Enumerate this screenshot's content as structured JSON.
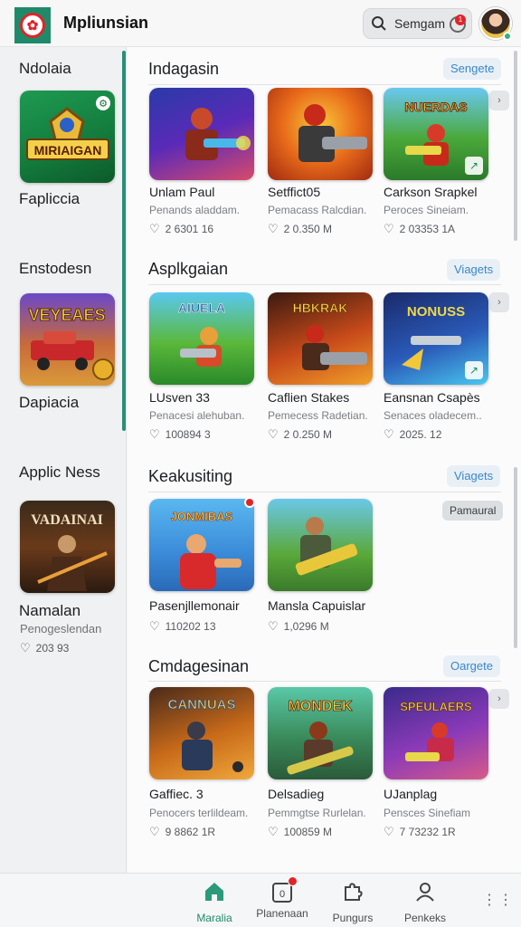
{
  "header": {
    "app_title": "Mpliunsian",
    "search_placeholder": "Semgam",
    "notification_count": "1"
  },
  "sidebar": {
    "groups": [
      {
        "heading": "Ndolaia",
        "card_art": "MIRIAIGAN",
        "label": "Fapliccia"
      },
      {
        "heading": "Enstodesn",
        "card_art": "VEYEAES",
        "label": "Dapiacia"
      },
      {
        "heading": "Applic Ness",
        "card_art": "VADAINAI",
        "label": "Namalan",
        "sub": "Penogeslendan",
        "meta": "203 93"
      }
    ]
  },
  "sections": [
    {
      "title": "Indagasin",
      "action": "Sengete",
      "tiles": [
        {
          "title": "Unlam Paul",
          "sub": "Penands aladdam.",
          "meta": "2 6301 16"
        },
        {
          "title": "Setffict05",
          "sub": "Pemacass Ralcdian.",
          "meta": "2 0.350 M"
        },
        {
          "title": "Carkson Srapkel",
          "sub": "Peroces Sineiam.",
          "meta": "2 03353 1A",
          "art": "NUERDAS"
        }
      ]
    },
    {
      "title": "Asplkgaian",
      "action": "Viagets",
      "tiles": [
        {
          "title": "LUsven 33",
          "sub": "Penacesi alehuban.",
          "meta": "100894 3",
          "art": "AIUELA"
        },
        {
          "title": "Caflien Stakes",
          "sub": "Pemecess Radetian.",
          "meta": "2 0.250 M",
          "art": "HBKRAK"
        },
        {
          "title": "Eansnan Csapès",
          "sub": "Senaces oladecem..",
          "meta": "2025. 12",
          "art": "NONUSS"
        }
      ]
    },
    {
      "title": "Keakusiting",
      "action": "Viagets",
      "side_button": "Pamaural",
      "tiles": [
        {
          "title": "Pasenjllemonair",
          "sub": "",
          "meta": "110202 13",
          "art": "JONMIBAS"
        },
        {
          "title": "Mansla Capuislar",
          "sub": "",
          "meta": "1,0296 M"
        }
      ]
    },
    {
      "title": "Cmdagesinan",
      "action": "Oargete",
      "tiles": [
        {
          "title": "Gaffiec. 3",
          "sub": "Penocers terlildeam.",
          "meta": "9 8862 1R",
          "art": "CANNUAS"
        },
        {
          "title": "Delsadieg",
          "sub": "Pemmgtse Rurlelan.",
          "meta": "100859 M",
          "art": "MONDEK"
        },
        {
          "title": "UJanplag",
          "sub": "Pensces Sinefiam",
          "meta": "7 73232 1R",
          "art": "SPEULAERS"
        }
      ]
    }
  ],
  "bottom_nav": [
    {
      "label": "Maralia",
      "icon": "home-icon"
    },
    {
      "label": "Planenaan",
      "icon": "inbox-icon"
    },
    {
      "label": "Pungurs",
      "icon": "puzzle-icon"
    },
    {
      "label": "Penkeks",
      "icon": "profile-icon"
    }
  ],
  "colors": {
    "accent": "#1f8a6a",
    "link": "#3a86c8",
    "badge": "#e0242a"
  }
}
